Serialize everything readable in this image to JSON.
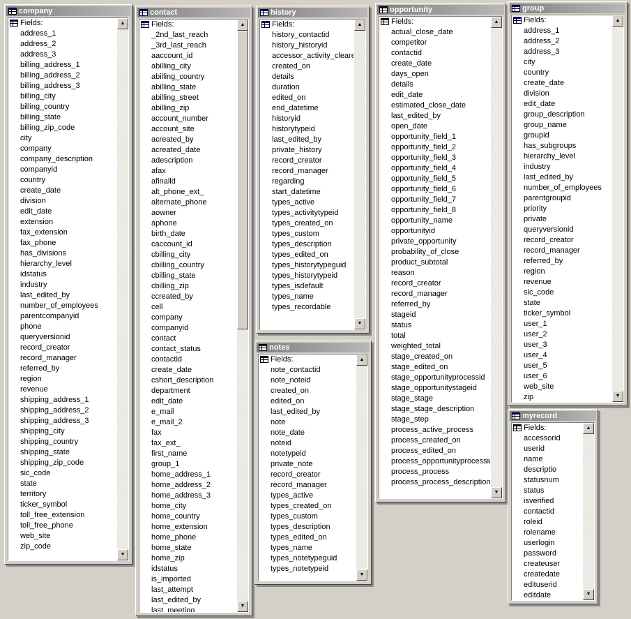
{
  "header_label": "Fields:",
  "scroll_up_glyph": "▲",
  "scroll_down_glyph": "▼",
  "tables": [
    {
      "name": "company",
      "fields": [
        "address_1",
        "address_2",
        "address_3",
        "billing_address_1",
        "billing_address_2",
        "billing_address_3",
        "billing_city",
        "billing_country",
        "billing_state",
        "billing_zip_code",
        "city",
        "company",
        "company_description",
        "companyid",
        "country",
        "create_date",
        "division",
        "edit_date",
        "extension",
        "fax_extension",
        "fax_phone",
        "has_divisions",
        "hierarchy_level",
        "idstatus",
        "industry",
        "last_edited_by",
        "number_of_employees",
        "parentcompanyid",
        "phone",
        "queryversionid",
        "record_creator",
        "record_manager",
        "referred_by",
        "region",
        "revenue",
        "shipping_address_1",
        "shipping_address_2",
        "shipping_address_3",
        "shipping_city",
        "shipping_country",
        "shipping_state",
        "shipping_zip_code",
        "sic_code",
        "state",
        "territory",
        "ticker_symbol",
        "toll_free_extension",
        "toll_free_phone",
        "web_site",
        "zip_code"
      ]
    },
    {
      "name": "contact",
      "fields": [
        "_2nd_last_reach",
        "_3rd_last_reach",
        "aaccount_id",
        "abilling_city",
        "abilling_country",
        "abilling_state",
        "abilling_street",
        "abilling_zip",
        "account_number",
        "account_site",
        "acreated_by",
        "acreated_date",
        "adescription",
        "afax",
        "afinalld",
        "alt_phone_ext_",
        "alternate_phone",
        "aowner",
        "aphone",
        "birth_date",
        "caccount_id",
        "cbilling_city",
        "cbilling_country",
        "cbilling_state",
        "cbilling_zip",
        "ccreated_by",
        "cell",
        "company",
        "companyid",
        "contact",
        "contact_status",
        "contactid",
        "create_date",
        "cshort_description",
        "department",
        "edit_date",
        "e_mail",
        "e_mail_2",
        "fax",
        "fax_ext_",
        "first_name",
        "group_1",
        "home_address_1",
        "home_address_2",
        "home_address_3",
        "home_city",
        "home_country",
        "home_extension",
        "home_phone",
        "home_state",
        "home_zip",
        "idstatus",
        "is_imported",
        "last_attempt",
        "last_edited_by",
        "last_meeting"
      ]
    },
    {
      "name": "history",
      "fields": [
        "history_contactid",
        "history_historyid",
        "accessor_activity_cleared",
        "created_on",
        "details",
        "duration",
        "edited_on",
        "end_datetime",
        "historyid",
        "historytypeid",
        "last_edited_by",
        "private_history",
        "record_creator",
        "record_manager",
        "regarding",
        "start_datetime",
        "types_active",
        "types_activitytypeid",
        "types_created_on",
        "types_custom",
        "types_description",
        "types_edited_on",
        "types_historytypeguid",
        "types_historytypeid",
        "types_isdefault",
        "types_name",
        "types_recordable"
      ]
    },
    {
      "name": "notes",
      "fields": [
        "note_contactid",
        "note_noteid",
        "created_on",
        "edited_on",
        "last_edited_by",
        "note",
        "note_date",
        "noteid",
        "notetypeid",
        "private_note",
        "record_creator",
        "record_manager",
        "types_active",
        "types_created_on",
        "types_custom",
        "types_description",
        "types_edited_on",
        "types_name",
        "types_notetypeguid",
        "types_notetypeid"
      ]
    },
    {
      "name": "opportunity",
      "fields": [
        "actual_close_date",
        "competitor",
        "contactid",
        "create_date",
        "days_open",
        "details",
        "edit_date",
        "estimated_close_date",
        "last_edited_by",
        "open_date",
        "opportunity_field_1",
        "opportunity_field_2",
        "opportunity_field_3",
        "opportunity_field_4",
        "opportunity_field_5",
        "opportunity_field_6",
        "opportunity_field_7",
        "opportunity_field_8",
        "opportunity_name",
        "opportunityid",
        "private_opportunity",
        "probability_of_close",
        "product_subtotal",
        "reason",
        "record_creator",
        "record_manager",
        "referred_by",
        "stageid",
        "status",
        "total",
        "weighted_total",
        "stage_created_on",
        "stage_edited_on",
        "stage_opportunityprocessid",
        "stage_opportunitystageid",
        "stage_stage",
        "stage_stage_description",
        "stage_step",
        "process_active_process",
        "process_created_on",
        "process_edited_on",
        "process_opportunityprocessid",
        "process_process",
        "process_process_description"
      ]
    },
    {
      "name": "group",
      "fields": [
        "address_1",
        "address_2",
        "address_3",
        "city",
        "country",
        "create_date",
        "division",
        "edit_date",
        "group_description",
        "group_name",
        "groupid",
        "has_subgroups",
        "hierarchy_level",
        "industry",
        "last_edited_by",
        "number_of_employees",
        "parentgroupid",
        "priority",
        "private",
        "queryversionid",
        "record_creator",
        "record_manager",
        "referred_by",
        "region",
        "revenue",
        "sic_code",
        "state",
        "ticker_symbol",
        "user_1",
        "user_2",
        "user_3",
        "user_4",
        "user_5",
        "user_6",
        "web_site",
        "zip"
      ]
    },
    {
      "name": "myrecord",
      "fields": [
        "accessorid",
        "userid",
        "name",
        "descriptio",
        "statusnum",
        "status",
        "isverified",
        "contactid",
        "roleid",
        "rolename",
        "userlogin",
        "password",
        "createuser",
        "createdate",
        "edituserid",
        "editdate"
      ]
    }
  ]
}
